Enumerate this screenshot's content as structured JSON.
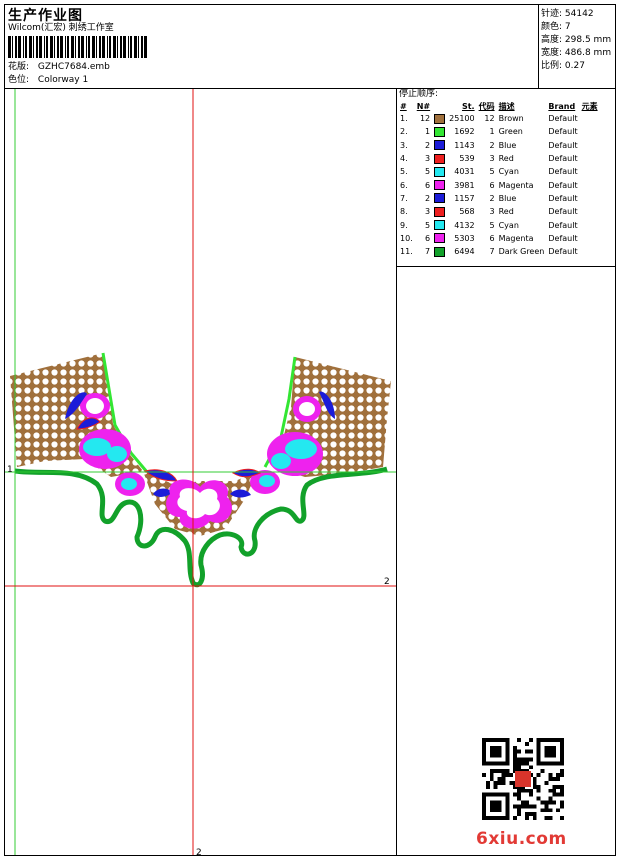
{
  "header": {
    "title": "生产作业图",
    "company": "Wilcom(汇宏) 刺绣工作室",
    "design_label": "花版:",
    "design_file": "GZHC7684.emb",
    "colorway_label": "色位:",
    "colorway": "Colorway 1"
  },
  "stats": [
    {
      "label": "针迹:",
      "value": "54142"
    },
    {
      "label": "颜色:",
      "value": "7"
    },
    {
      "label": "高度:",
      "value": "298.5 mm"
    },
    {
      "label": "宽度:",
      "value": "486.8 mm"
    },
    {
      "label": "比例:",
      "value": "0.27"
    }
  ],
  "sequence": {
    "title": "停止顺序:",
    "columns": [
      "#",
      "N#",
      "St.",
      "代码",
      "描述",
      "Brand",
      "元素"
    ],
    "rows": [
      {
        "idx": "1.",
        "n": "12",
        "color": "#a0703c",
        "st": "25100",
        "code": "12",
        "desc": "Brown",
        "brand": "Default"
      },
      {
        "idx": "2.",
        "n": "1",
        "color": "#33e633",
        "st": "1692",
        "code": "1",
        "desc": "Green",
        "brand": "Default"
      },
      {
        "idx": "3.",
        "n": "2",
        "color": "#1c1cd8",
        "st": "1143",
        "code": "2",
        "desc": "Blue",
        "brand": "Default"
      },
      {
        "idx": "4.",
        "n": "3",
        "color": "#ee1f1f",
        "st": "539",
        "code": "3",
        "desc": "Red",
        "brand": "Default"
      },
      {
        "idx": "5.",
        "n": "5",
        "color": "#24e8f0",
        "st": "4031",
        "code": "5",
        "desc": "Cyan",
        "brand": "Default"
      },
      {
        "idx": "6.",
        "n": "6",
        "color": "#ee22ee",
        "st": "3981",
        "code": "6",
        "desc": "Magenta",
        "brand": "Default"
      },
      {
        "idx": "7.",
        "n": "2",
        "color": "#1c1cd8",
        "st": "1157",
        "code": "2",
        "desc": "Blue",
        "brand": "Default"
      },
      {
        "idx": "8.",
        "n": "3",
        "color": "#ee1f1f",
        "st": "568",
        "code": "3",
        "desc": "Red",
        "brand": "Default"
      },
      {
        "idx": "9.",
        "n": "5",
        "color": "#24e8f0",
        "st": "4132",
        "code": "5",
        "desc": "Cyan",
        "brand": "Default"
      },
      {
        "idx": "10.",
        "n": "6",
        "color": "#ee22ee",
        "st": "5303",
        "code": "6",
        "desc": "Magenta",
        "brand": "Default"
      },
      {
        "idx": "11.",
        "n": "7",
        "color": "#12a12a",
        "st": "6494",
        "code": "7",
        "desc": "Dark Green",
        "brand": "Default"
      }
    ]
  },
  "guides": {
    "mark_left": "1",
    "mark_right": "2",
    "mark_bottom": "2"
  },
  "watermark": "6xiu.com"
}
